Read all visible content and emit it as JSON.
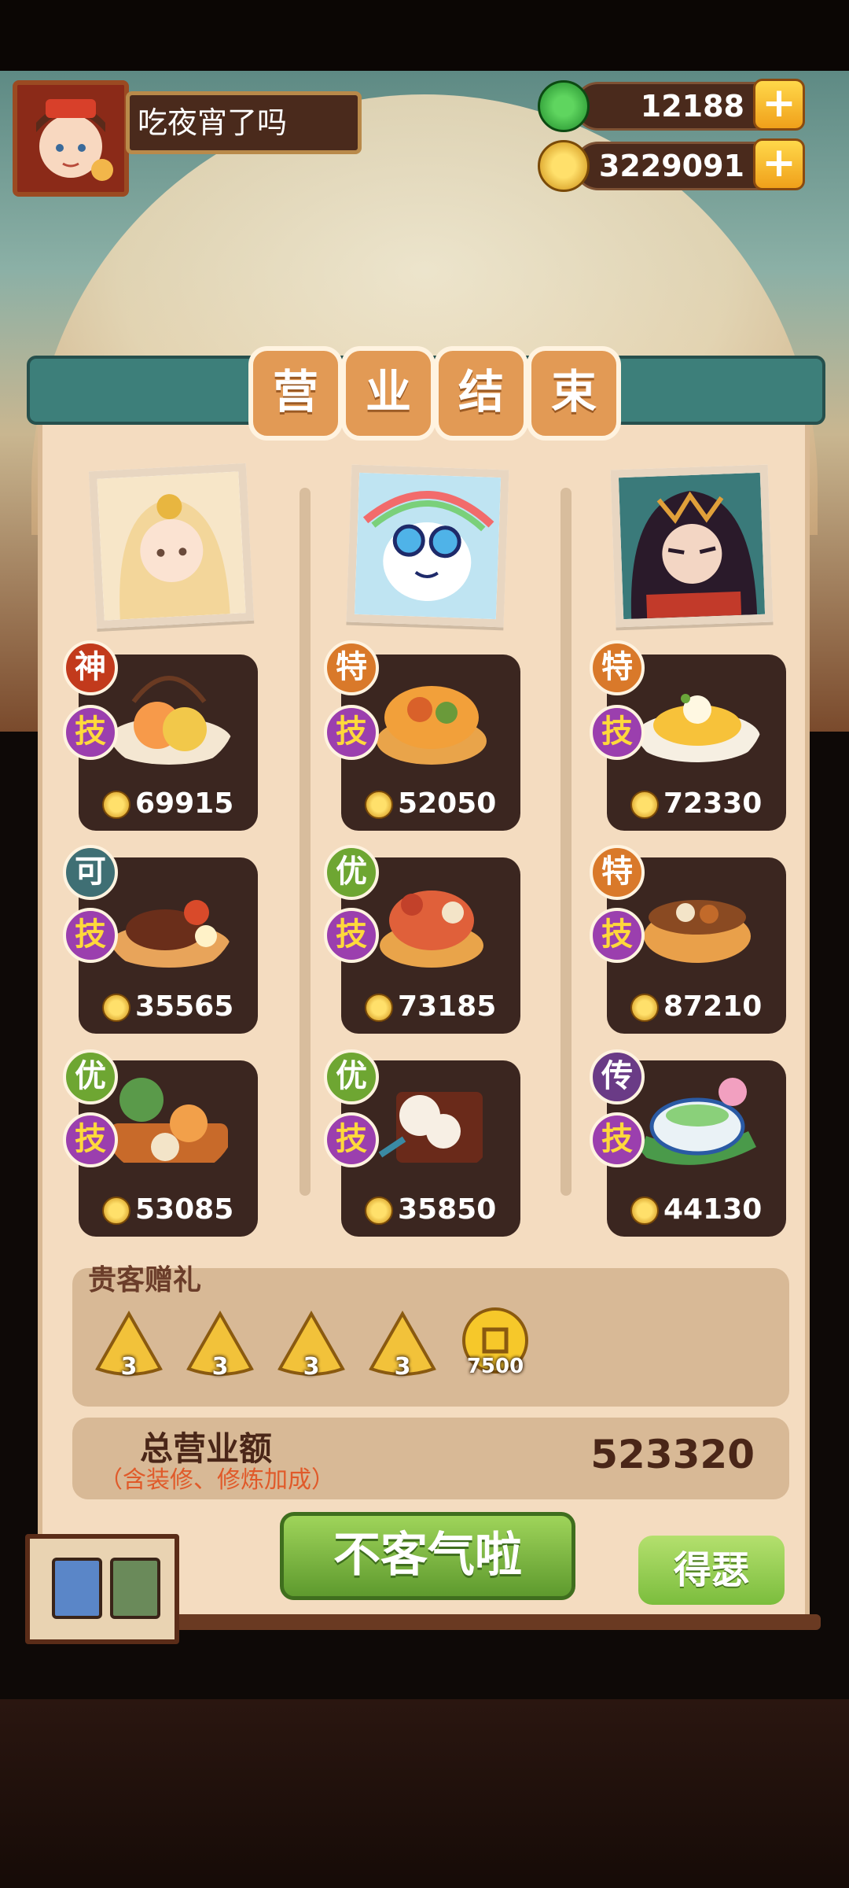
{
  "player": {
    "name": "吃夜宵了吗"
  },
  "resources": {
    "jade": "12188",
    "coins": "3229091",
    "plus_label": "+"
  },
  "title_chars": [
    "营",
    "业",
    "结",
    "束"
  ],
  "chefs": [
    {
      "portrait": "chef-girl-portrait"
    },
    {
      "portrait": "chef-bunny-portrait"
    },
    {
      "portrait": "chef-dark-portrait"
    }
  ],
  "dishes": [
    [
      {
        "grade": "神",
        "grade_color": "#c23a1c",
        "skill": "技",
        "price": "69915"
      },
      {
        "grade": "可",
        "grade_color": "#3f6f74",
        "skill": "技",
        "price": "35565"
      },
      {
        "grade": "优",
        "grade_color": "#6ea632",
        "skill": "技",
        "price": "53085"
      }
    ],
    [
      {
        "grade": "特",
        "grade_color": "#d9792a",
        "skill": "技",
        "price": "52050"
      },
      {
        "grade": "优",
        "grade_color": "#6ea632",
        "skill": "技",
        "price": "73185"
      },
      {
        "grade": "优",
        "grade_color": "#6ea632",
        "skill": "技",
        "price": "35850"
      }
    ],
    [
      {
        "grade": "特",
        "grade_color": "#d9792a",
        "skill": "技",
        "price": "72330"
      },
      {
        "grade": "特",
        "grade_color": "#d9792a",
        "skill": "技",
        "price": "87210"
      },
      {
        "grade": "传",
        "grade_color": "#6a3b86",
        "skill": "技",
        "price": "44130"
      }
    ]
  ],
  "gifts": {
    "title": "贵客赠礼",
    "items": [
      {
        "icon": "wonton-scroll-icon",
        "count": "3"
      },
      {
        "icon": "wonton-glyph-icon",
        "count": "3"
      },
      {
        "icon": "wonton-fish-icon",
        "count": "3"
      },
      {
        "icon": "wonton-fish-icon",
        "count": "3"
      },
      {
        "icon": "coin-icon",
        "count": "7500"
      }
    ]
  },
  "total": {
    "label": "总营业额",
    "sub": "（含装修、修炼加成）",
    "value": "523320"
  },
  "buttons": {
    "confirm": "不客气啦",
    "share": "得瑟"
  }
}
